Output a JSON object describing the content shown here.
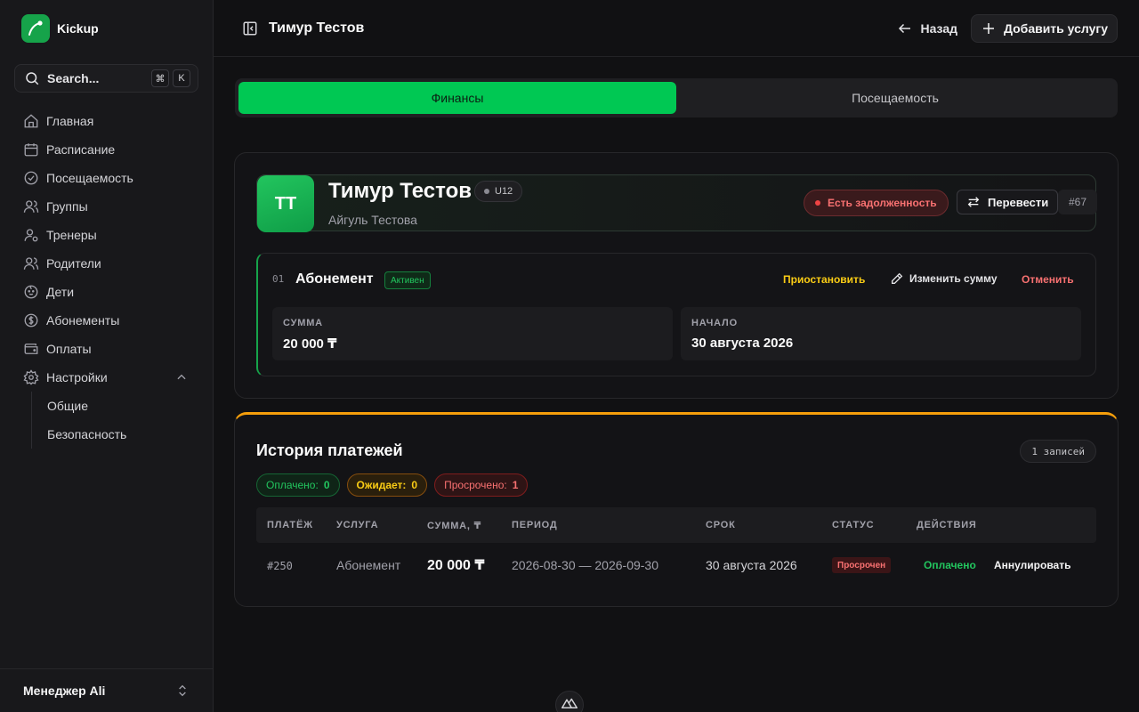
{
  "app": {
    "name": "Kickup"
  },
  "search": {
    "label": "Search...",
    "kbd1": "⌘",
    "kbd2": "K"
  },
  "sidebar": {
    "items": [
      {
        "label": "Главная",
        "icon": "home-icon"
      },
      {
        "label": "Расписание",
        "icon": "calendar-icon"
      },
      {
        "label": "Посещаемость",
        "icon": "check-circle-icon"
      },
      {
        "label": "Группы",
        "icon": "users-icon"
      },
      {
        "label": "Тренеры",
        "icon": "user-cog-icon"
      },
      {
        "label": "Родители",
        "icon": "users-icon"
      },
      {
        "label": "Дети",
        "icon": "baby-icon"
      },
      {
        "label": "Абонементы",
        "icon": "dollar-circle-icon"
      },
      {
        "label": "Оплаты",
        "icon": "wallet-icon"
      },
      {
        "label": "Настройки",
        "icon": "gear-icon"
      }
    ],
    "settings_sub": [
      "Общие",
      "Безопасность"
    ],
    "user": "Менеджер Ali"
  },
  "header": {
    "title": "Тимур Тестов",
    "back": "Назад",
    "add_service": "Добавить услугу"
  },
  "tabs": [
    {
      "label": "Финансы",
      "active": true
    },
    {
      "label": "Посещаемость",
      "active": false
    }
  ],
  "profile": {
    "initials": "ТТ",
    "name": "Тимур Тестов",
    "age_group": "U12",
    "parent": "Айгуль Тестова",
    "debt_status": "Есть задолженность",
    "transfer": "Перевести",
    "id": "#67"
  },
  "subscription": {
    "index": "01",
    "name": "Абонемент",
    "status": "Активен",
    "actions": {
      "pause": "Приостановить",
      "edit": "Изменить сумму",
      "cancel": "Отменить"
    },
    "amount_label": "СУММА",
    "amount": "20 000 ₸",
    "start_label": "НАЧАЛО",
    "start": "30 августа 2026"
  },
  "payments": {
    "title": "История платежей",
    "count": "1 записей",
    "chips": {
      "paid_label": "Оплачено:",
      "paid_value": "0",
      "wait_label": "Ожидает:",
      "wait_value": "0",
      "over_label": "Просрочено:",
      "over_value": "1"
    },
    "columns": [
      "ПЛАТЁЖ",
      "УСЛУГА",
      "СУММА, ₸",
      "ПЕРИОД",
      "СРОК",
      "СТАТУС",
      "ДЕЙСТВИЯ"
    ],
    "rows": [
      {
        "id": "#250",
        "service": "Абонемент",
        "amount": "20 000 ₸",
        "period": "2026-08-30 — 2026-09-30",
        "due": "30 августа 2026",
        "status": "Просрочен",
        "action_paid": "Оплачено",
        "action_void": "Аннулировать"
      }
    ]
  },
  "colors": {
    "accent": "#00c853",
    "danger": "#f87171",
    "warning": "#facc15",
    "card_top": "#f59e0b"
  }
}
